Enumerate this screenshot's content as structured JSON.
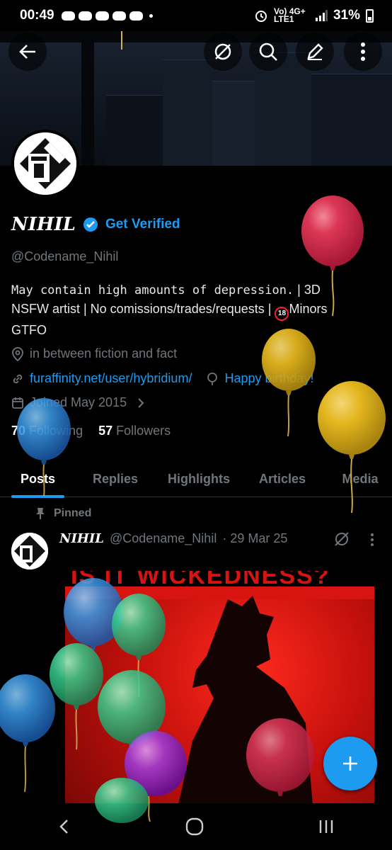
{
  "status": {
    "time": "00:49",
    "network": "Vo) 4G+ LTE1",
    "battery": "31%"
  },
  "profile": {
    "name": "NIHIL",
    "get_verified": "Get Verified",
    "handle": "@Codename_Nihil",
    "bio_line1": "May contain high amounts of depression.",
    "bio_line1b": " | 3D",
    "bio_line2": "NSFW artist | No comissions/trades/requests | ",
    "bio_badge": "18",
    "bio_line2b": "Minors",
    "bio_line3": "GTFO",
    "location": "in between fiction and fact",
    "website": "furaffinity.net/user/hybridium/",
    "birthday": "Happy birthday!",
    "joined": "Joined May 2015",
    "following_count": "70",
    "following_label": "Following",
    "followers_count": "57",
    "followers_label": "Followers"
  },
  "tabs": [
    "Posts",
    "Replies",
    "Highlights",
    "Articles",
    "Media"
  ],
  "post": {
    "pinned": "Pinned",
    "name": "NIHIL",
    "handle": "@Codename_Nihil",
    "date": "· 29 Mar 25",
    "image_text": "IS IT WICKEDNESS?"
  },
  "colors": {
    "accent": "#1d9bf0",
    "muted": "#71767b"
  },
  "icons": [
    "back-arrow-icon",
    "grok-icon",
    "search-icon",
    "edit-icon",
    "more-icon",
    "verified-icon",
    "location-icon",
    "link-icon",
    "birthday-icon",
    "calendar-icon",
    "chevron-right-icon",
    "pin-icon",
    "plus-icon"
  ]
}
